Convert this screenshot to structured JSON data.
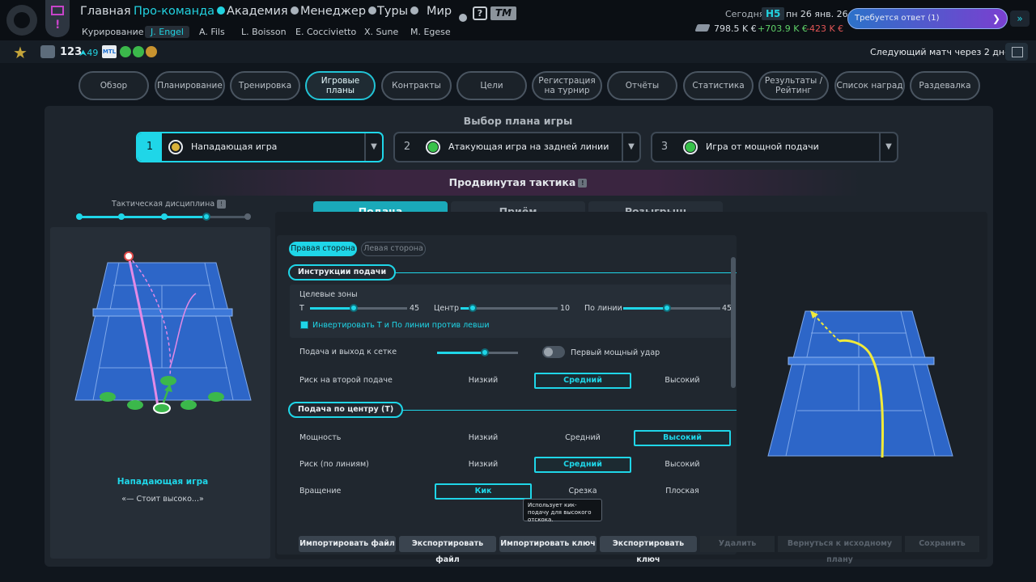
{
  "nav": {
    "items": [
      {
        "label": "Главная",
        "dot": false
      },
      {
        "label": "Про-команда",
        "dot": true
      },
      {
        "label": "Академия",
        "dot": true
      },
      {
        "label": "Менеджер",
        "dot": true
      },
      {
        "label": "Туры",
        "dot": true
      },
      {
        "label": "Мир",
        "dot": false
      }
    ],
    "question": "?",
    "tm_logo": "TM",
    "sub": [
      "Курирование",
      "J. Engel",
      "A. Fils",
      "L. Boisson",
      "E. Coccivietto",
      "X. Sune",
      "M. Egese"
    ],
    "sub_active": "J. Engel"
  },
  "status": {
    "today_label": "Сегодня",
    "week": "Н5",
    "date": "пн 26 янв. 26",
    "balance": "798.5 K €",
    "income": "+703.9 K €",
    "expense": "-423 K €",
    "respond": "Требуется ответ (1)",
    "respond_chevron": "❯",
    "forward_icon": "»"
  },
  "bar2": {
    "rank": "123",
    "rank_change": "⮝49",
    "mtl": "MTL",
    "next_match": "Следующий матч через 2 дней"
  },
  "tabs": [
    "Обзор",
    "Планирование",
    "Тренировка",
    "Игровые планы",
    "Контракты",
    "Цели",
    "Регистрация на турнир",
    "Отчёты",
    "Статистика",
    "Результаты / Рейтинг",
    "Список наград",
    "Раздевалка"
  ],
  "active_tab": "Игровые планы",
  "plan": {
    "title": "Выбор плана игры",
    "slots": [
      {
        "num": "1",
        "label": "Нападающая игра",
        "circle": "#d8b13a"
      },
      {
        "num": "2",
        "label": "Атакующая игра на задней линии",
        "circle": "#38c24a"
      },
      {
        "num": "3",
        "label": "Игра от мощной подачи",
        "circle": "#38c24a"
      }
    ],
    "dropdown_icon": "▼",
    "advanced": "Продвинутая тактика",
    "info_icon": "!"
  },
  "discipline": {
    "label": "Тактическая дисциплина",
    "info_icon": "!",
    "level": 3,
    "max": 4
  },
  "subtabs": [
    "Подача",
    "Приём",
    "Розыгрыш"
  ],
  "sides": [
    "Правая сторона",
    "Левая сторона"
  ],
  "serve_instructions": {
    "title": "Инструкции подачи",
    "target_zones": "Целевые зоны",
    "zones": [
      {
        "label": "T",
        "value": "45",
        "pos": 0.45
      },
      {
        "label": "Центр",
        "value": "10",
        "pos": 0.1
      },
      {
        "label": "По линии",
        "value": "45",
        "pos": 0.45
      }
    ],
    "invert": "Инвертировать Т и По линии против левши",
    "serve_volley": "Подача и выход к сетке",
    "serve_volley_pos": 0.6,
    "first_power": "Первый мощный удар",
    "second_risk": "Риск на второй подаче",
    "second_risk_options": [
      "Низкий",
      "Средний",
      "Высокий"
    ],
    "second_risk_selected": 1
  },
  "center_serve": {
    "title": "Подача по центру (Т)",
    "rows": [
      {
        "label": "Мощность",
        "options": [
          "Низкий",
          "Средний",
          "Высокий"
        ],
        "selected": 2
      },
      {
        "label": "Риск (по линиям)",
        "options": [
          "Низкий",
          "Средний",
          "Высокий"
        ],
        "selected": 1
      },
      {
        "label": "Вращение",
        "options": [
          "Кик",
          "Срезка",
          "Плоская"
        ],
        "selected": 0
      }
    ],
    "tooltip": "Использует кик-подачу для высокого отскока."
  },
  "left_panel": {
    "plan_name": "Нападающая игра",
    "quote": "«— Стоит высоко...»"
  },
  "buttons": {
    "import_file": "Импортировать файл",
    "export_file": "Экспортировать файл",
    "import_key": "Импортировать ключ",
    "export_key": "Экспортировать ключ",
    "delete": "Удалить",
    "revert": "Вернуться к исходному плану",
    "save": "Сохранить"
  },
  "colors": {
    "accent": "#1fd6e8",
    "court": "#2d66c8",
    "court_line": "#7fa8ea",
    "plan_path": "#e38ae6",
    "serve_path": "#f1ea3a",
    "player_dot": "#3bb84b"
  }
}
